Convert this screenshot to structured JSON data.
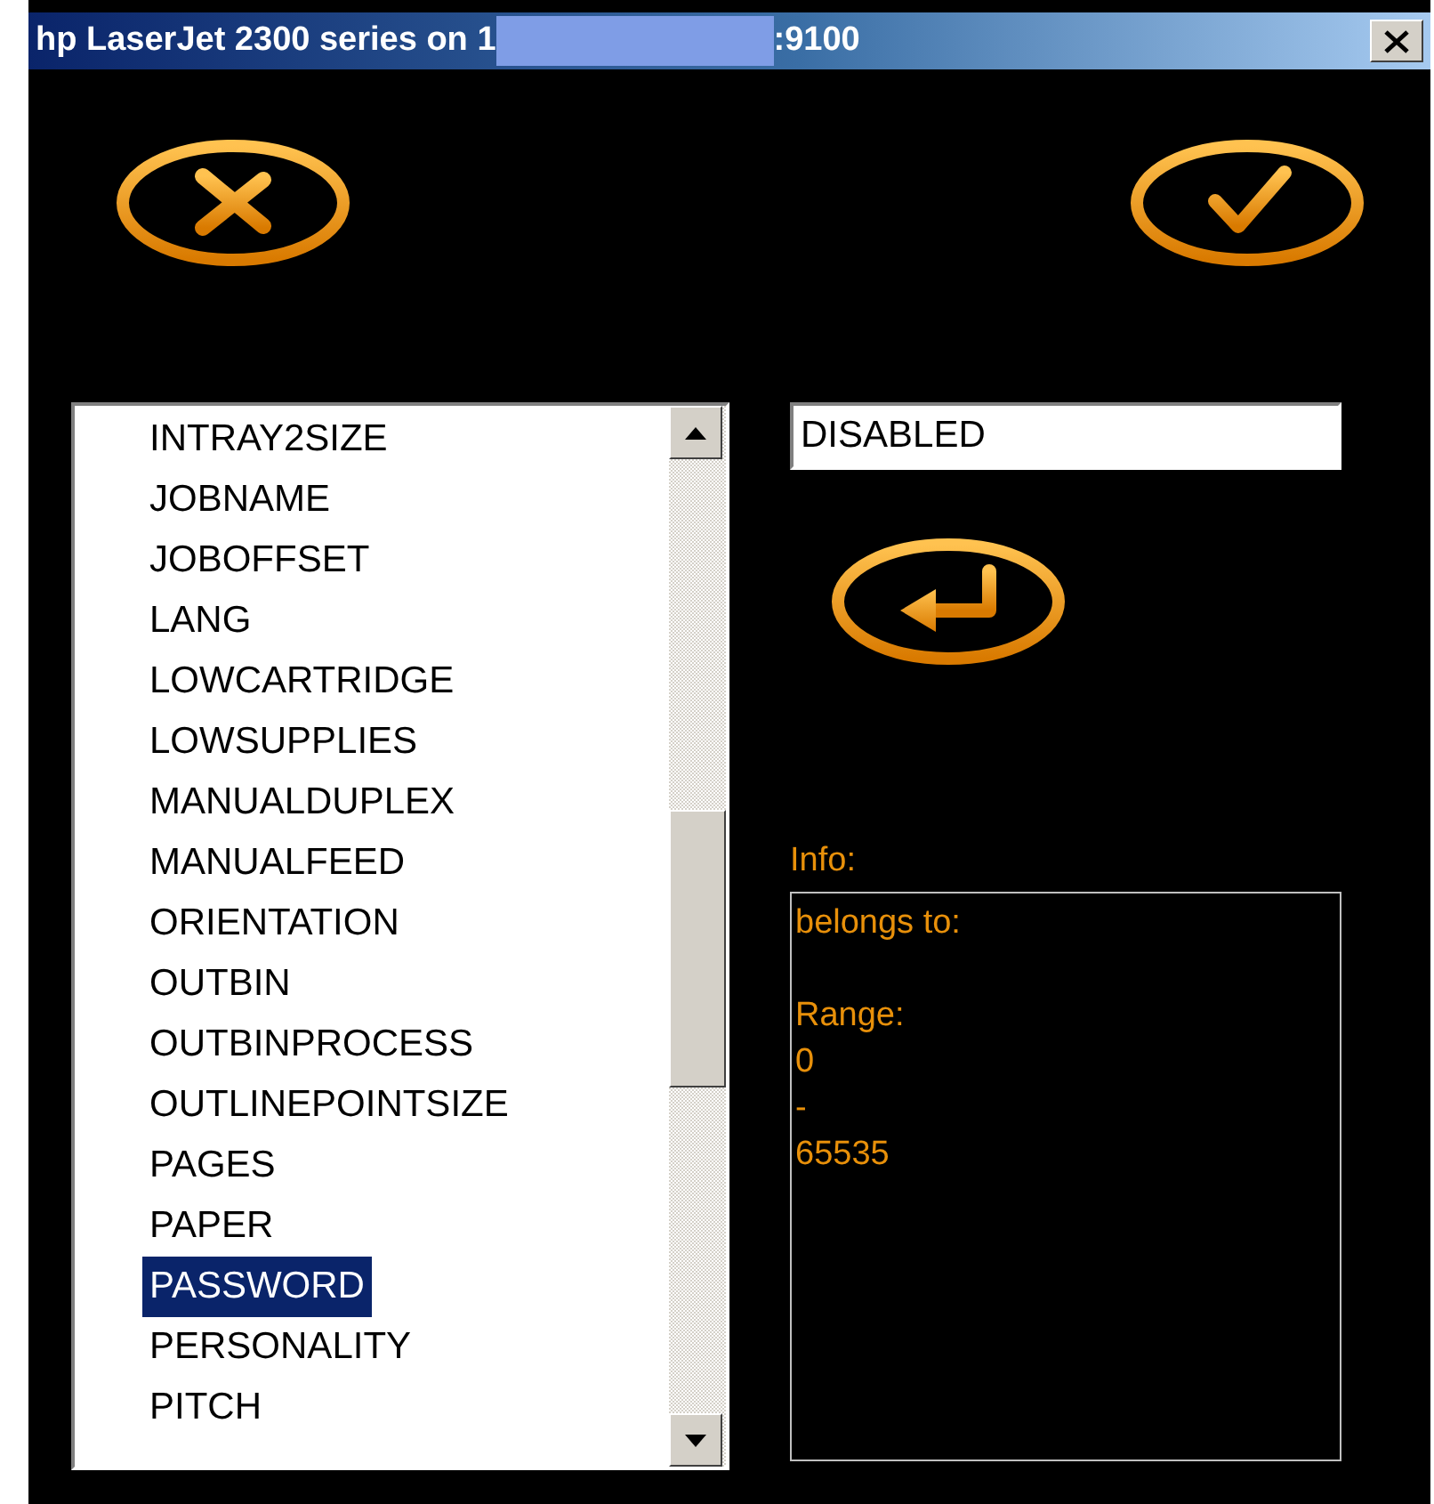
{
  "window": {
    "title_parts": [
      {
        "kind": "text",
        "text": "hp LaserJet 2300 series on 1"
      },
      {
        "kind": "redacted"
      },
      {
        "kind": "text",
        "text": ":9100"
      }
    ]
  },
  "toolbar": {
    "buttons": [
      {
        "kind": "cancel"
      },
      {
        "kind": "ok"
      }
    ]
  },
  "list": {
    "items": [
      {
        "label": "INTRAY2SIZE",
        "selected": false
      },
      {
        "label": "JOBNAME",
        "selected": false
      },
      {
        "label": "JOBOFFSET",
        "selected": false
      },
      {
        "label": "LANG",
        "selected": false
      },
      {
        "label": "LOWCARTRIDGE",
        "selected": false
      },
      {
        "label": "LOWSUPPLIES",
        "selected": false
      },
      {
        "label": "MANUALDUPLEX",
        "selected": false
      },
      {
        "label": "MANUALFEED",
        "selected": false
      },
      {
        "label": "ORIENTATION",
        "selected": false
      },
      {
        "label": "OUTBIN",
        "selected": false
      },
      {
        "label": "OUTBINPROCESS",
        "selected": false
      },
      {
        "label": "OUTLINEPOINTSIZE",
        "selected": false
      },
      {
        "label": "PAGES",
        "selected": false
      },
      {
        "label": "PAPER",
        "selected": false
      },
      {
        "label": "PASSWORD",
        "selected": true
      },
      {
        "label": "PERSONALITY",
        "selected": false
      },
      {
        "label": "PITCH",
        "selected": false
      }
    ]
  },
  "value_field": {
    "value": "DISABLED"
  },
  "apply_button": {
    "kind": "enter"
  },
  "info": {
    "label": "Info:",
    "paragraphs": [
      [
        "belongs to:"
      ],
      [
        "Range:",
        "0",
        "-",
        "65535"
      ]
    ]
  }
}
